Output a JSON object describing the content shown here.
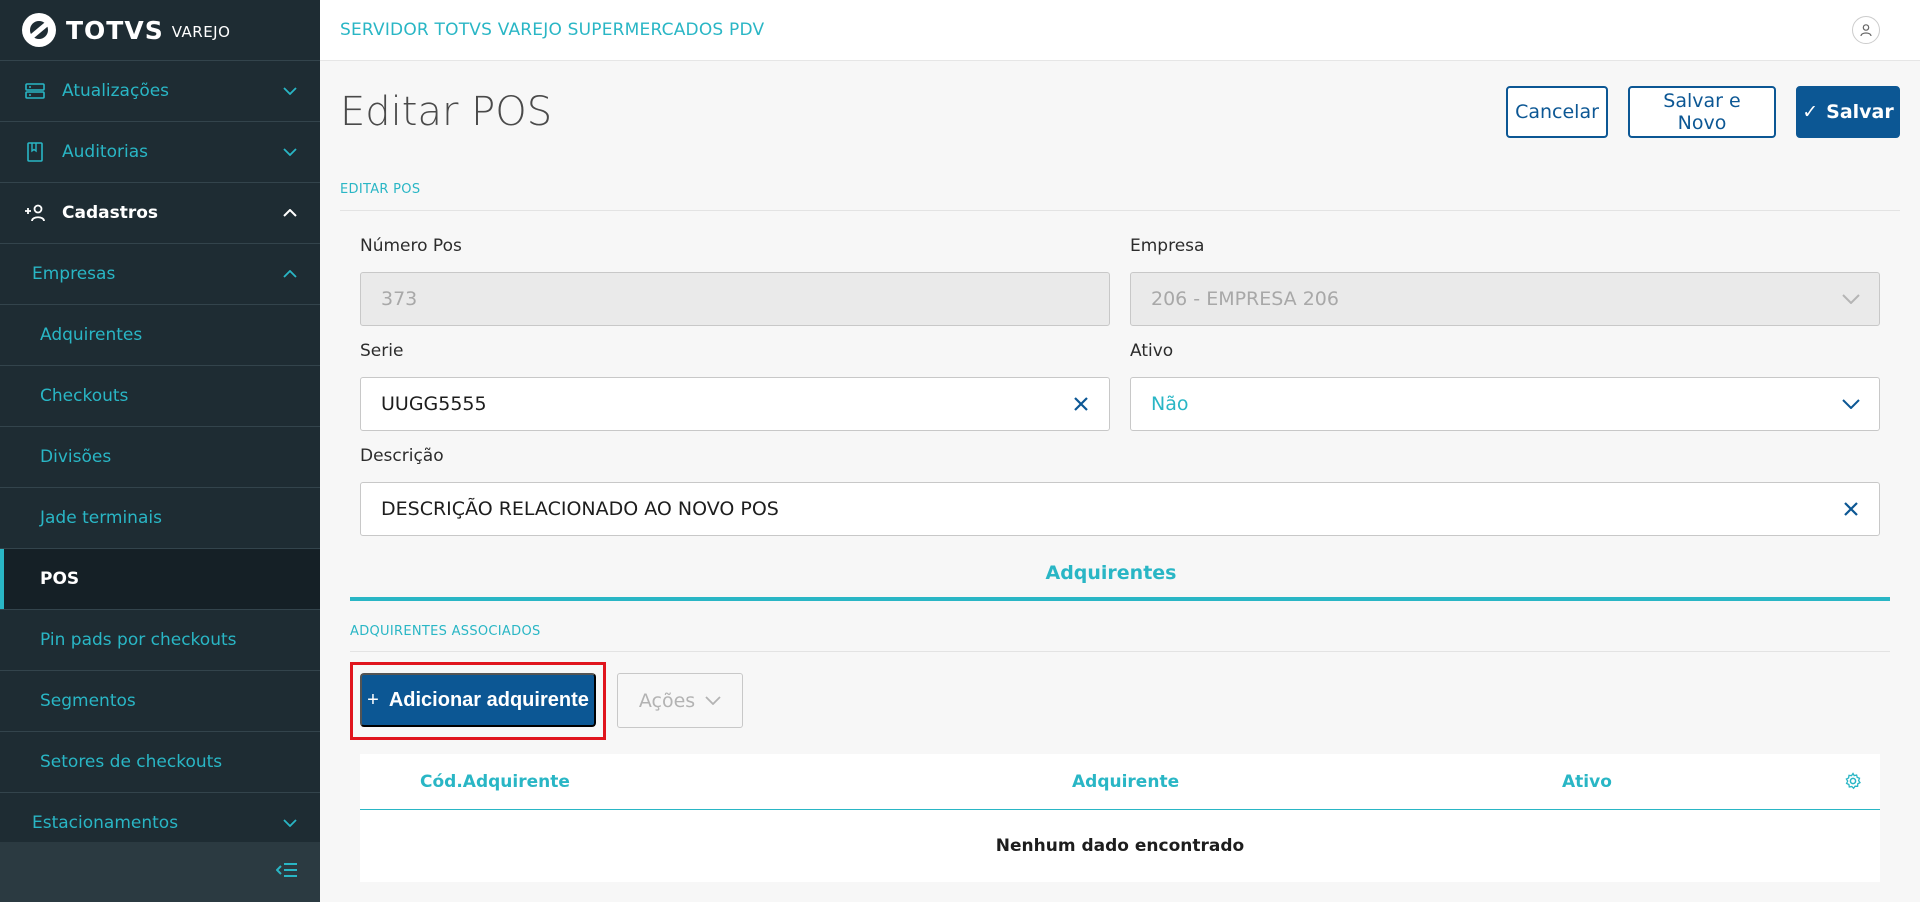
{
  "brand": {
    "name": "TOTVS",
    "sub": "VAREJO"
  },
  "sidebar": {
    "items": [
      {
        "label": "Atualizações"
      },
      {
        "label": "Auditorias"
      },
      {
        "label": "Cadastros"
      },
      {
        "label": "Empresas"
      },
      {
        "label": "Adquirentes"
      },
      {
        "label": "Checkouts"
      },
      {
        "label": "Divisões"
      },
      {
        "label": "Jade terminais"
      },
      {
        "label": "POS"
      },
      {
        "label": "Pin pads por checkouts"
      },
      {
        "label": "Segmentos"
      },
      {
        "label": "Setores de checkouts"
      },
      {
        "label": "Estacionamentos"
      }
    ]
  },
  "header": {
    "app_title": "SERVIDOR TOTVS VAREJO SUPERMERCADOS PDV"
  },
  "page": {
    "title": "Editar POS",
    "buttons": {
      "cancel": "Cancelar",
      "save_new": "Salvar e Novo",
      "save": "Salvar"
    },
    "section_label": "EDITAR POS"
  },
  "form": {
    "numero_pos": {
      "label": "Número Pos",
      "value": "373"
    },
    "empresa": {
      "label": "Empresa",
      "value": "206 - EMPRESA 206"
    },
    "serie": {
      "label": "Serie",
      "value": "UUGG5555"
    },
    "ativo": {
      "label": "Ativo",
      "value": "Não"
    },
    "descricao": {
      "label": "Descrição",
      "value": "DESCRIÇÃO RELACIONADO AO NOVO POS"
    }
  },
  "tabs": {
    "active": "Adquirentes"
  },
  "adquirentes": {
    "section_label": "ADQUIRENTES ASSOCIADOS",
    "add_button": "Adicionar adquirente",
    "actions_button": "Ações",
    "columns": [
      "Cód.Adquirente",
      "Adquirente",
      "Ativo"
    ],
    "empty": "Nenhum dado encontrado"
  },
  "colors": {
    "primary": "#0c5794",
    "accent": "#29b6c5",
    "sidebar": "#1e2c33",
    "highlight": "#e0151d"
  }
}
